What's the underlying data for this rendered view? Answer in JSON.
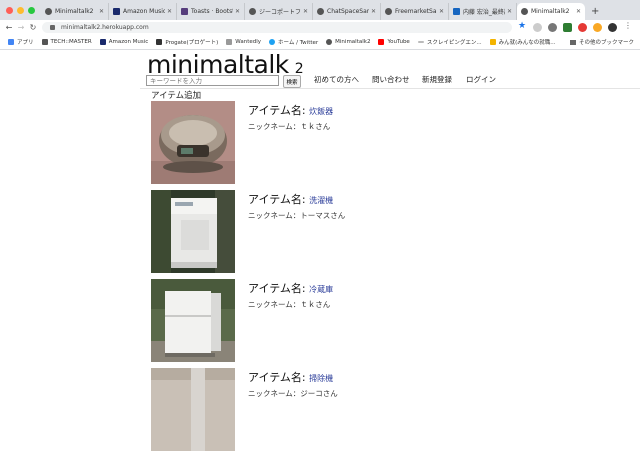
{
  "browser": {
    "tabs": [
      {
        "title": "Minimaltalk2"
      },
      {
        "title": "Amazon Music - E"
      },
      {
        "title": "Toasts · Bootstrap"
      },
      {
        "title": "ジーコポートフォリ"
      },
      {
        "title": "ChatSpaceSample"
      },
      {
        "title": "FreemarketSample"
      },
      {
        "title": "内藤 宏治_最終課題"
      },
      {
        "title": "Minimaltalk2"
      }
    ],
    "url": "minimaltalk2.herokuapp.com",
    "bookmarks": [
      {
        "label": "アプリ"
      },
      {
        "label": "TECH::MASTER"
      },
      {
        "label": "Amazon Music"
      },
      {
        "label": "Progate(プロゲート)"
      },
      {
        "label": "Wantedly"
      },
      {
        "label": "ホーム / Twitter"
      },
      {
        "label": "Minimaltalk2"
      },
      {
        "label": "YouTube"
      },
      {
        "label": "スクレイピングエン..."
      },
      {
        "label": "みん就(みんなの就職..."
      }
    ],
    "other_bookmarks": "その他のブックマーク",
    "colors": {
      "tabbar": "#dee1e6",
      "accent": "#1a73e8"
    }
  },
  "header": {
    "logo": "minimaltalk",
    "logo_suffix": "2",
    "search_placeholder": "キーワードを入力",
    "search_button": "検索",
    "nav": [
      {
        "label": "初めての方へ"
      },
      {
        "label": "問い合わせ"
      },
      {
        "label": "新規登録"
      },
      {
        "label": "ログイン"
      }
    ]
  },
  "main": {
    "add_item_label": "アイテム追加",
    "items": [
      {
        "title_prefix": "アイテム名:",
        "name": "炊飯器",
        "nickname": "ニックネーム：ｔｋさん",
        "image": "rice-cooker"
      },
      {
        "title_prefix": "アイテム名:",
        "name": "洗濯機",
        "nickname": "ニックネーム：トーマスさん",
        "image": "washing-machine"
      },
      {
        "title_prefix": "アイテム名:",
        "name": "冷蔵庫",
        "nickname": "ニックネーム：ｔｋさん",
        "image": "refrigerator"
      },
      {
        "title_prefix": "アイテム名:",
        "name": "掃除機",
        "nickname": "ニックネーム：ジーコさん",
        "image": "vacuum-cleaner"
      }
    ]
  }
}
